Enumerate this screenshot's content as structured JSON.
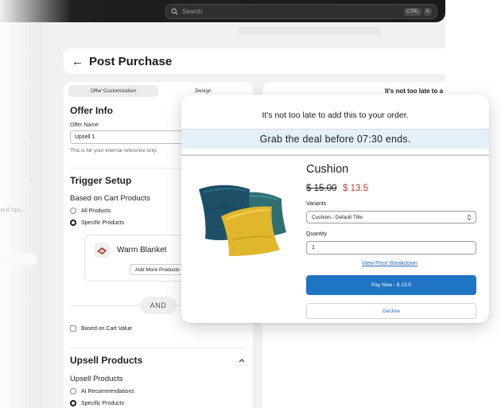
{
  "topbar": {
    "search_placeholder": "Search",
    "shortcut_keys": [
      "CTRL",
      "K"
    ]
  },
  "sidebar": {
    "partial_label": "and Ups..."
  },
  "page": {
    "back_icon": "arrow-left-icon",
    "title": "Post Purchase"
  },
  "editor": {
    "tabs": [
      {
        "label": "Offer Customization",
        "active": true
      },
      {
        "label": "Design",
        "active": false
      }
    ],
    "offer_info": {
      "title": "Offer Info",
      "name_label": "Offer Name",
      "name_value": "Upsell 1",
      "help_text": "This is for your internal reference only."
    },
    "trigger_setup": {
      "title": "Trigger Setup",
      "subtitle": "Based on Cart Products",
      "options": [
        {
          "label": "All Products",
          "selected": false
        },
        {
          "label": "Specific Products",
          "selected": true
        }
      ],
      "product_name": "Warm Blanket",
      "add_more_label": "Add More Products",
      "and_label": "AND",
      "cart_value_label": "Based on Cart Value"
    },
    "upsell_products": {
      "title": "Upsell Products",
      "subtitle": "Upsell Products",
      "options": [
        {
          "label": "AI Recommendations",
          "selected": false
        },
        {
          "label": "Specific Products",
          "selected": true
        }
      ]
    }
  },
  "preview_strip": {
    "heading_partial": "It's not too late to a"
  },
  "popup": {
    "heading": "It's not too late to add this to your order.",
    "banner": "Grab the deal before 07:30 ends.",
    "product": {
      "name": "Cushion",
      "old_price": "$ 15.00",
      "new_price": "$ 13.5"
    },
    "variants_label": "Variants",
    "variant_value": "Cushion - Default Title",
    "quantity_label": "Quantity",
    "quantity_value": "1",
    "breakdown_link": "View Price Breakdown",
    "pay_button": "Pay Now - $ 13.5",
    "decline_button": "Decline",
    "colors": {
      "pay_button": "#1f74c4",
      "sale_price": "#d7322c",
      "banner_bg": "#e5f1fa",
      "link": "#2b6cb0"
    }
  }
}
